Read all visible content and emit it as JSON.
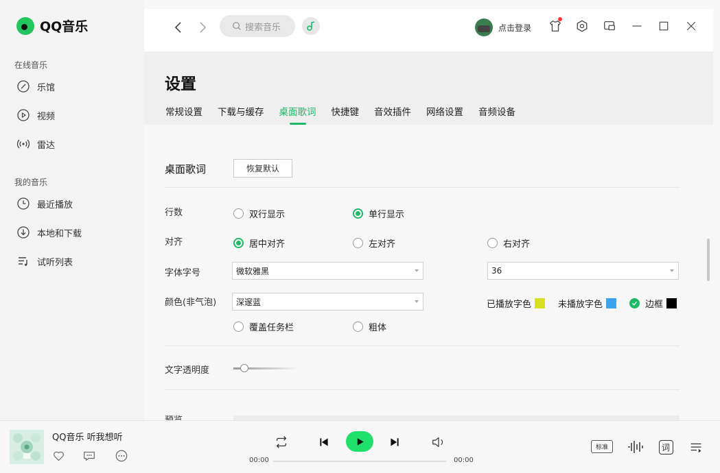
{
  "app": {
    "name": "QQ音乐"
  },
  "sidebar": {
    "groups": [
      {
        "title": "在线音乐",
        "items": [
          {
            "label": "乐馆",
            "icon": "compass-icon"
          },
          {
            "label": "视频",
            "icon": "play-circle-icon"
          },
          {
            "label": "雷达",
            "icon": "radar-icon"
          }
        ]
      },
      {
        "title": "我的音乐",
        "items": [
          {
            "label": "最近播放",
            "icon": "clock-icon"
          },
          {
            "label": "本地和下载",
            "icon": "download-icon"
          },
          {
            "label": "试听列表",
            "icon": "playlist-icon"
          }
        ]
      }
    ]
  },
  "topbar": {
    "search_placeholder": "搜索音乐",
    "login_label": "点击登录"
  },
  "settings": {
    "title": "设置",
    "tabs": [
      "常规设置",
      "下载与缓存",
      "桌面歌词",
      "快捷键",
      "音效插件",
      "网络设置",
      "音频设备"
    ],
    "active_tab": "桌面歌词",
    "section_title": "桌面歌词",
    "reset_label": "恢复默认",
    "lines": {
      "label": "行数",
      "options": [
        "双行显示",
        "单行显示"
      ],
      "selected": "单行显示"
    },
    "align": {
      "label": "对齐",
      "options": [
        "居中对齐",
        "左对齐",
        "右对齐"
      ],
      "selected": "居中对齐"
    },
    "font": {
      "label": "字体字号",
      "family": "微软雅黑",
      "size": "36"
    },
    "color": {
      "label": "颜色(非气泡)",
      "scheme": "深邃蓝",
      "played_label": "已播放字色",
      "played_color": "#d8e020",
      "unplayed_label": "未播放字色",
      "unplayed_color": "#3aa5ee",
      "border_label": "边框",
      "border_color": "#000000",
      "border_checked": true
    },
    "cover_taskbar": {
      "label": "覆盖任务栏",
      "checked": false
    },
    "bold": {
      "label": "粗体",
      "checked": false
    },
    "opacity": {
      "label": "文字透明度",
      "value": 0.1
    },
    "preview_label": "预览"
  },
  "player": {
    "song": "QQ音乐 听我想听",
    "time_current": "00:00",
    "time_total": "00:00",
    "quality_label": "标准",
    "lyrics_label": "词"
  },
  "colors": {
    "accent": "#1fb866",
    "play": "#1fe06a"
  }
}
